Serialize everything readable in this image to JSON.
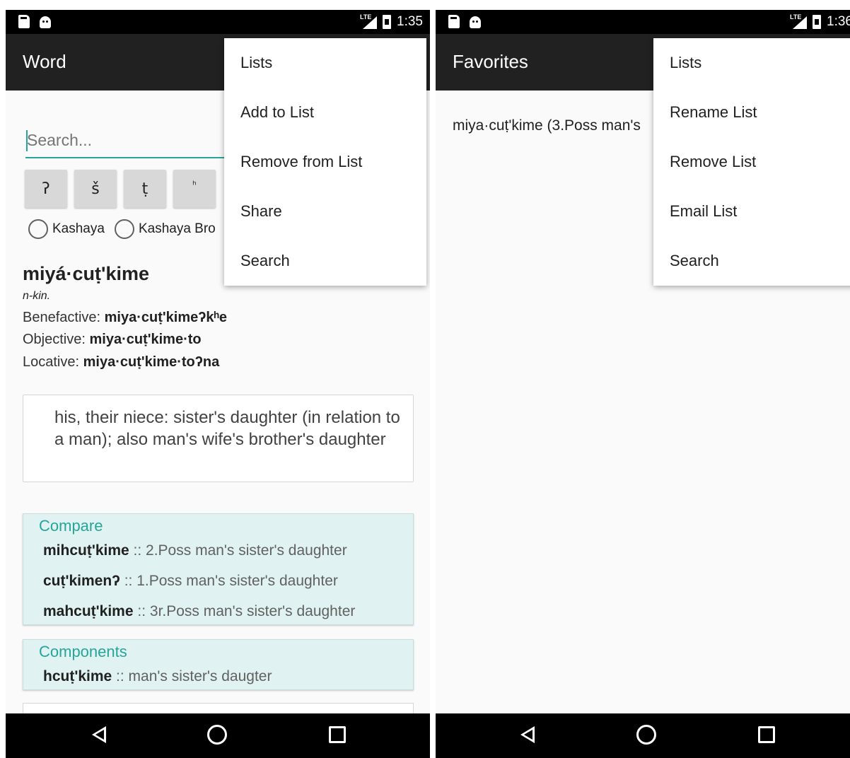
{
  "left": {
    "status": {
      "time": "1:35",
      "network": "LTE"
    },
    "appbar_title": "Word",
    "search": {
      "placeholder": "Search..."
    },
    "char_buttons": [
      "ʔ",
      "š",
      "ṭ",
      "ʰ"
    ],
    "radios": [
      {
        "label": "Kashaya",
        "checked": false
      },
      {
        "label": "Kashaya Bro",
        "checked": false
      }
    ],
    "entry": {
      "headword": "miyá·cuṭ'kime",
      "pos": "n-kin.",
      "forms": [
        {
          "label": "Benefactive:",
          "value": "miya·cuṭ'kimeʔkʰe"
        },
        {
          "label": "Objective:",
          "value": "miya·cuṭ'kime·to"
        },
        {
          "label": "Locative:",
          "value": "miya·cuṭ'kime·toʔna"
        }
      ],
      "definition": "his, their niece: sister's daughter (in relation to a man); also man's wife's brother's daughter"
    },
    "compare": {
      "title": "Compare",
      "items": [
        {
          "word": "mihcuṭ'kime",
          "gloss": " :: 2.Poss man's sister's daughter"
        },
        {
          "word": "cuṭ'kimenʔ",
          "gloss": " :: 1.Poss man's sister's daughter"
        },
        {
          "word": "mahcuṭ'kime",
          "gloss": " :: 3r.Poss man's sister's daughter"
        }
      ]
    },
    "components": {
      "title": "Components",
      "items": [
        {
          "word": "hcuṭ'kime",
          "gloss": " :: man's sister's daugter"
        }
      ]
    },
    "menu": [
      "Lists",
      "Add to List",
      "Remove from List",
      "Share",
      "Search"
    ]
  },
  "right": {
    "status": {
      "time": "1:36",
      "network": "LTE"
    },
    "appbar_title": "Favorites",
    "favorites": [
      "miya·cuṭ'kime (3.Poss man's"
    ],
    "menu": [
      "Lists",
      "Rename List",
      "Remove List",
      "Email List",
      "Search"
    ]
  },
  "colors": {
    "accent": "#26a69a",
    "appbar": "#212121",
    "section_bg": "#e0f2f1"
  },
  "icons": [
    "sd-card-icon",
    "android-icon",
    "signal-icon",
    "battery-icon",
    "back-icon",
    "home-icon",
    "recents-icon"
  ]
}
